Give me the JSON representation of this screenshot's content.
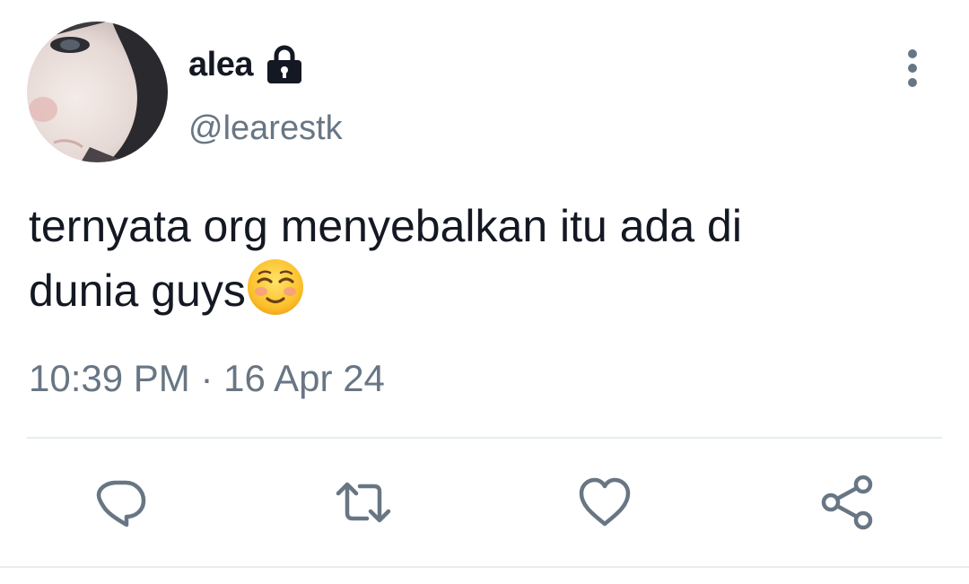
{
  "tweet": {
    "display_name": "alea",
    "handle": "@learestk",
    "text_line1": "ternyata org menyebalkan itu ada di",
    "text_line2": "dunia guys",
    "timestamp": "10:39 PM · 16 Apr 24"
  },
  "icons": {
    "lock": "lock-icon",
    "more": "vertical-dots-icon",
    "emoji": "smiling-face-with-smiling-eyes",
    "reply": "reply-icon",
    "retweet": "retweet-icon",
    "like": "heart-icon",
    "share": "share-icon"
  },
  "colors": {
    "text_primary": "#141823",
    "text_secondary": "#687684",
    "divider": "#e6ecf0"
  }
}
